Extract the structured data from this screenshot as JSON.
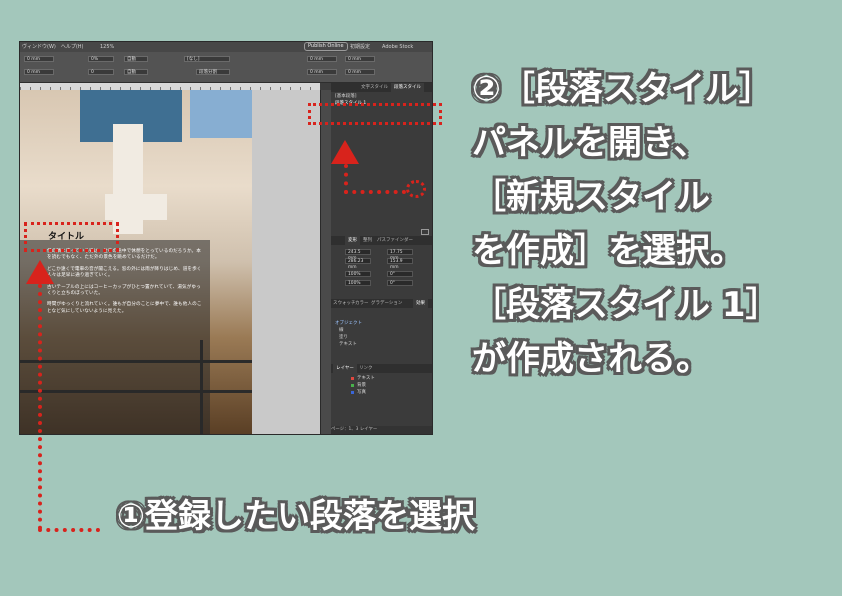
{
  "app": {
    "menu_left": "ヴィンドウ(W)　ヘルプ(H)",
    "zoom": "125%",
    "publish_button": "Publish Online",
    "workspace": "初期設定",
    "search_placeholder": "Adobe Stock"
  },
  "control_bar": {
    "fields": [
      "0 mm",
      "0 mm",
      "0 mm",
      "0 mm",
      "[なし]",
      "0%",
      "0",
      "自動",
      "自動",
      "段落分割"
    ]
  },
  "paragraph_styles_panel": {
    "tabs": [
      "段落スタイル",
      "文字スタイル"
    ],
    "items": [
      "[基本段落]",
      "段落スタイル 1"
    ]
  },
  "transform_panel": {
    "tabs": [
      "変形",
      "整列",
      "パスファインダー"
    ],
    "x": "243.5 mm",
    "y": "286.23 mm",
    "w": "17.75 mm",
    "h": "153.9 mm",
    "scale_x": "100%",
    "scale_y": "100%",
    "rot": "0°",
    "shear": "0°"
  },
  "swatches_panel": {
    "tabs": [
      "スウォッチ",
      "カラー",
      "グラデーション",
      "効果"
    ],
    "rows": [
      "オブジェクト",
      "線",
      "塗り",
      "テキスト"
    ]
  },
  "layers_panel": {
    "tabs": [
      "レイヤー",
      "リンク"
    ],
    "layers": [
      {
        "name": "テキスト",
        "color": "#e0473f"
      },
      {
        "name": "背景",
        "color": "#48b24c"
      },
      {
        "name": "写真",
        "color": "#3a66d8"
      }
    ],
    "status": "ページ：1、3 レイヤー"
  },
  "document": {
    "heading": "タイトル",
    "paragraphs": [
      "僕の隣に座っている男は、仕事の途中で休憩をとっているのだろうか。本を読むでもなく、ただ外の景色を眺めているだけだ。",
      "どこか遠くで電車の音が聞こえる。窓の外には雨が降りはじめ、道を歩く人々は足早に通り過ぎていく。",
      "古いテーブルの上にはコーヒーカップがひとつ置かれていて、湯気がゆっくりと立ちのぼっていた。",
      "時間がゆっくりと流れていく。誰もが自分のことに夢中で、誰も他人のことなど気にしていないように見えた。"
    ]
  },
  "captions": {
    "step2": "②［段落スタイル］\nパネルを開き、\n［新規スタイル\nを作成］を選択。\n［段落スタイル 1］\nが作成される。",
    "step1": "①登録したい段落を選択"
  },
  "colors": {
    "background": "#a3c7bb",
    "highlight": "#d8231c",
    "caption_text": "#ffffff",
    "caption_outline": "#5a5a5a"
  }
}
